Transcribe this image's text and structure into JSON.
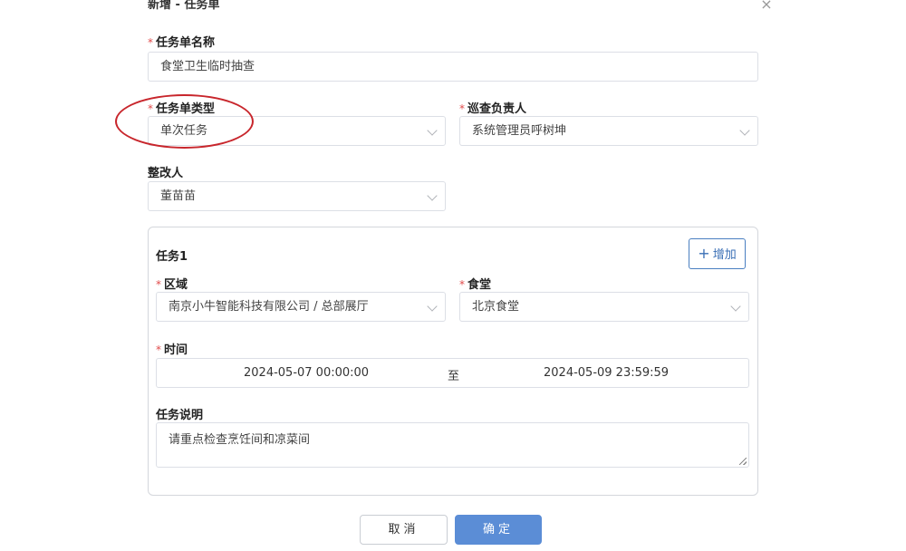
{
  "dialog": {
    "title": "新增 - 任务单",
    "close_symbol": "×"
  },
  "form": {
    "required_mark": "*",
    "name": {
      "label": "任务单名称",
      "value": "食堂卫生临时抽查"
    },
    "type": {
      "label": "任务单类型",
      "value": "单次任务"
    },
    "inspector": {
      "label": "巡查负责人",
      "value": "系统管理员呼树坤"
    },
    "rectifier": {
      "label": "整改人",
      "value": "董苗苗"
    }
  },
  "task": {
    "title": "任务1",
    "add_label": "增加",
    "add_icon": "+",
    "area": {
      "label": "区域",
      "value": "南京小牛智能科技有限公司 / 总部展厅"
    },
    "canteen": {
      "label": "食堂",
      "value": "北京食堂"
    },
    "time": {
      "label": "时间",
      "start": "2024-05-07 00:00:00",
      "separator": "至",
      "end": "2024-05-09 23:59:59"
    },
    "description": {
      "label": "任务说明",
      "value": "请重点检查烹饪间和凉菜间"
    }
  },
  "footer": {
    "cancel_label": "取消",
    "ok_label": "确定"
  },
  "colors": {
    "primary": "#5b8dd6",
    "required": "#e14b4b",
    "highlight": "#c8262c"
  }
}
